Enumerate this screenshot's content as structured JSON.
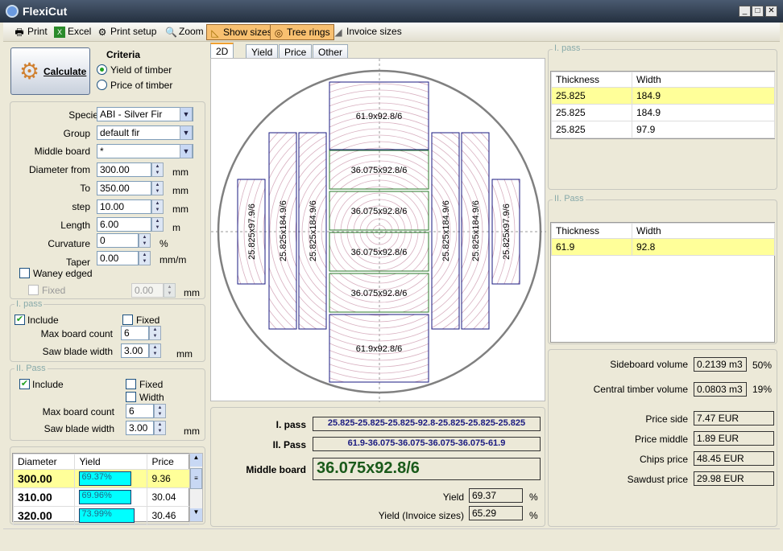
{
  "app": {
    "title": "FlexiCut"
  },
  "toolbar": [
    {
      "label": "Print",
      "icon": "printer-icon"
    },
    {
      "label": "Excel",
      "icon": "excel-icon"
    },
    {
      "label": "Print setup",
      "icon": "print-setup-icon"
    },
    {
      "label": "Zoom",
      "icon": "zoom-icon"
    },
    {
      "label": "Show sizes",
      "icon": "ruler-triangle-icon",
      "active": true
    },
    {
      "label": "Tree rings",
      "icon": "tree-rings-icon",
      "active": true
    },
    {
      "label": "Invoice sizes",
      "icon": "invoice-sizes-icon"
    }
  ],
  "calculate": {
    "label": "Calculate"
  },
  "criteria": {
    "title": "Criteria",
    "options": [
      "Yield of timber",
      "Price of timber"
    ],
    "selected": "Yield of timber"
  },
  "params": {
    "species_label": "Species",
    "species": "ABI - Silver Fir",
    "group_label": "Group",
    "group": "default fir",
    "middle_label": "Middle board",
    "middle": "*",
    "diam_from_label": "Diameter from",
    "diam_from": "300.00",
    "to_label": "To",
    "to": "350.00",
    "step_label": "step",
    "step": "10.00",
    "length_label": "Length",
    "length": "6.00",
    "curv_label": "Curvature",
    "curv": "0",
    "taper_label": "Taper",
    "taper": "0.00",
    "waney_label": "Waney edged",
    "fixed_label": "Fixed",
    "fixed_val": "0.00",
    "u_mm": "mm",
    "u_m": "m",
    "u_pct": "%",
    "u_mmm": "mm/m"
  },
  "pass1": {
    "title": "I. pass",
    "include": "Include",
    "fixed": "Fixed",
    "max_label": "Max board count",
    "max": "6",
    "saw_label": "Saw blade width",
    "saw": "3.00",
    "unit": "mm"
  },
  "pass2": {
    "title": "II. Pass",
    "include": "Include",
    "fixed": "Fixed",
    "width": "Width",
    "max_label": "Max board count",
    "max": "6",
    "saw_label": "Saw blade width",
    "saw": "3.00",
    "unit": "mm"
  },
  "results": {
    "headers": [
      "Diameter",
      "Yield",
      "Price"
    ],
    "rows": [
      {
        "d": "300.00",
        "y": "69.37%",
        "yv": 69.37,
        "p": "9.36"
      },
      {
        "d": "310.00",
        "y": "69.96%",
        "yv": 69.96,
        "p": "30.04"
      },
      {
        "d": "320.00",
        "y": "73.99%",
        "yv": 73.99,
        "p": "30.46"
      }
    ]
  },
  "tabs": [
    "2D",
    "Yield",
    "Price",
    "Other"
  ],
  "drawing": {
    "top": "61.9x92.8/6",
    "bottom": "61.9x92.8/6",
    "middle": [
      "36.075x92.8/6",
      "36.075x92.8/6",
      "36.075x92.8/6",
      "36.075x92.8/6"
    ],
    "sides": [
      "25.825x97.9/6",
      "25.825x184.9/6",
      "25.825x184.9/6",
      "25.825x184.9/6",
      "25.825x184.9/6",
      "25.825x97.9/6"
    ]
  },
  "summary": {
    "p1_label": "I. pass",
    "p1": "25.825-25.825-25.825-92.8-25.825-25.825-25.825",
    "p2_label": "II. Pass",
    "p2": "61.9-36.075-36.075-36.075-36.075-61.9",
    "mb_label": "Middle board",
    "mb": "36.075x92.8/6",
    "yield_label": "Yield",
    "yield": "69.37",
    "yi_label": "Yield (Invoice sizes)",
    "yi": "65.29",
    "pct": "%"
  },
  "right": {
    "p1_title": "I. pass",
    "p2_title": "II. Pass",
    "headers": [
      "Thickness",
      "Width"
    ],
    "p1_rows": [
      [
        "25.825",
        "184.9"
      ],
      [
        "25.825",
        "184.9"
      ],
      [
        "25.825",
        "97.9"
      ]
    ],
    "p2_rows": [
      [
        "61.9",
        "92.8"
      ]
    ],
    "side_label": "Sideboard volume",
    "side": "0.2139 m3",
    "side_pct": "50%",
    "central_label": "Central timber volume",
    "central": "0.0803 m3",
    "central_pct": "19%",
    "prices": [
      {
        "label": "Price side",
        "value": "7.47 EUR"
      },
      {
        "label": "Price middle",
        "value": "1.89 EUR"
      },
      {
        "label": "Chips price",
        "value": "48.45 EUR"
      },
      {
        "label": "Sawdust price",
        "value": "29.98 EUR"
      }
    ]
  },
  "colors": {
    "highlight": "#ffff99",
    "yield_bar": "#00ffff",
    "middle_board_text": "#1a5a1a",
    "pass_text": "#1a1a80"
  }
}
